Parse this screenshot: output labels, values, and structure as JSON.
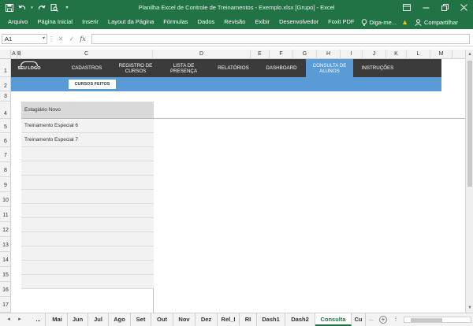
{
  "window": {
    "title": "Planilha Excel de Controle de Treinamentos - Exemplo.xlsx  [Grupo] - Excel",
    "icons": [
      "save-icon",
      "undo-icon",
      "redo-icon",
      "print-preview-icon",
      "qat-customize-icon",
      "ribbon-display-icon",
      "minimize-icon",
      "restore-icon",
      "close-icon"
    ]
  },
  "ribbon": {
    "tabs": [
      "Arquivo",
      "Página Inicial",
      "Inserir",
      "Layout da Página",
      "Fórmulas",
      "Dados",
      "Revisão",
      "Exibir",
      "Desenvolvedor",
      "Foxit PDF"
    ],
    "tell_me": "Diga-me...",
    "share": "Compartilhar"
  },
  "formula_bar": {
    "name_box": "A1",
    "cancel": "✕",
    "enter": "✓",
    "fx": "fx",
    "value": ""
  },
  "columns": [
    "A",
    "B",
    "C",
    "D",
    "E",
    "F",
    "G",
    "H",
    "I",
    "J",
    "K",
    "L",
    "M"
  ],
  "rows": [
    "1",
    "2",
    "3",
    "4",
    "5",
    "6",
    "7",
    "8",
    "9",
    "10",
    "11",
    "12",
    "13",
    "14",
    "15",
    "16",
    "17"
  ],
  "sheet": {
    "logo": "SEU LOGO",
    "nav": [
      {
        "label": "CADASTROS"
      },
      {
        "label": "REGISTRO DE CURSOS"
      },
      {
        "label": "LISTA DE PRESENÇA"
      },
      {
        "label": "RELATÓRIOS"
      },
      {
        "label": "DASHBOARD"
      },
      {
        "label": "CONSULTA DE ALUNOS"
      },
      {
        "label": "INSTRUÇÕES"
      }
    ],
    "active_nav": "CONSULTA DE ALUNOS",
    "sub_button": "CURSOS FEITOS",
    "table": {
      "header": "Estagiário Novo",
      "rows": [
        "Treinamento Especial 6",
        "Treinamento Especial 7",
        "",
        "",
        "",
        "",
        "",
        "",
        "",
        "",
        "",
        ""
      ]
    },
    "colors": {
      "nav_bg": "#3b3b3b",
      "active_bg": "#5b9bd5",
      "excel_green": "#217346"
    }
  },
  "sheet_tabs": {
    "items": [
      "...",
      "Mai",
      "Jun",
      "Jul",
      "Ago",
      "Set",
      "Out",
      "Nov",
      "Dez",
      "Rel_I",
      "RI",
      "Dash1",
      "Dash2",
      "Consulta",
      "Cu"
    ],
    "active": "Consulta",
    "more": "...",
    "add": "+"
  }
}
